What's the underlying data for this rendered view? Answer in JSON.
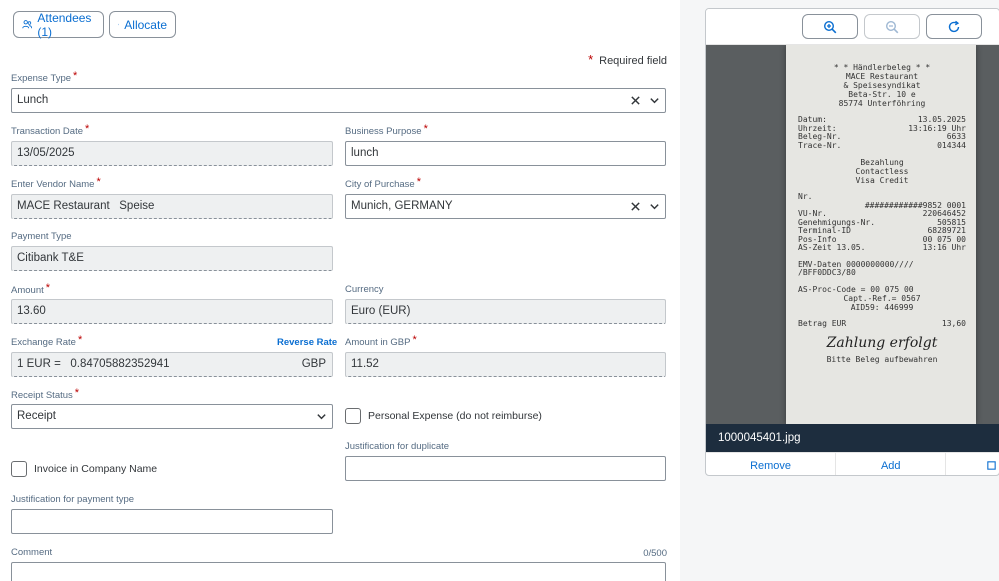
{
  "toolbar": {
    "attendees_label": "Attendees (1)",
    "allocate_label": "Allocate"
  },
  "required_note": "Required field",
  "form": {
    "expense_type": {
      "label": "Expense Type",
      "value": "Lunch"
    },
    "transaction_date": {
      "label": "Transaction Date",
      "value": "13/05/2025"
    },
    "business_purpose": {
      "label": "Business Purpose",
      "value": "lunch"
    },
    "vendor_name": {
      "label": "Enter Vendor Name",
      "value": "MACE Restaurant   Speise"
    },
    "city_of_purchase": {
      "label": "City of Purchase",
      "value": "Munich, GERMANY"
    },
    "payment_type": {
      "label": "Payment Type",
      "value": "Citibank T&E"
    },
    "amount": {
      "label": "Amount",
      "value": "13.60"
    },
    "currency": {
      "label": "Currency",
      "value": "Euro (EUR)"
    },
    "exchange_rate": {
      "label": "Exchange Rate",
      "reverse_label": "Reverse Rate",
      "prefix": "1 EUR =",
      "value": "0.84705882352941",
      "suffix": "GBP"
    },
    "amount_in_gbp": {
      "label": "Amount in GBP",
      "value": "11.52"
    },
    "receipt_status": {
      "label": "Receipt Status",
      "value": "Receipt"
    },
    "personal_expense": {
      "label": "Personal Expense (do not reimburse)",
      "checked": false
    },
    "justification_duplicate": {
      "label": "Justification for duplicate",
      "value": ""
    },
    "invoice_company": {
      "label": "Invoice in Company Name",
      "checked": false
    },
    "justification_payment": {
      "label": "Justification for payment type",
      "value": ""
    },
    "comment": {
      "label": "Comment",
      "value": "",
      "counter": "0/500"
    }
  },
  "viewer": {
    "icons": [
      "zoom-in-icon",
      "zoom-out-icon",
      "refresh-icon"
    ],
    "file_name": "1000045401.jpg",
    "remove_label": "Remove",
    "add_label": "Add",
    "receipt": {
      "header": [
        "* * Händlerbeleg * *",
        "MACE Restaurant",
        "& Speisesyndikat",
        "Beta-Str. 10 e",
        "85774 Unterföhring"
      ],
      "datum_label": "Datum:",
      "datum": "13.05.2025",
      "uhrzeit_label": "Uhrzeit:",
      "uhrzeit": "13:16:19 Uhr",
      "beleg_label": "Beleg-Nr.",
      "beleg": "6633",
      "trace_label": "Trace-Nr.",
      "trace": "014344",
      "payment": [
        "Bezahlung",
        "Contactless",
        "Visa Credit"
      ],
      "nr_label": "Nr.",
      "card": "############9852 0001",
      "vu_label": "VU-Nr.",
      "vu": "220646452",
      "gen_label": "Genehmigungs-Nr.",
      "gen": "505815",
      "term_label": "Terminal-ID",
      "term": "68289721",
      "pos_label": "Pos-Info",
      "pos": "00 075 00",
      "as_label": "AS-Zeit 13.05.",
      "as": "13:16 Uhr",
      "emv1": "EMV-Daten 0000000000////",
      "emv2": "/BFF0DDC3/80",
      "asproc": "AS-Proc-Code = 00 075 00",
      "capt": "Capt.-Ref.= 0567",
      "aid": "AID59: 446999",
      "betrag_label": "Betrag EUR",
      "betrag": "13,60",
      "zahlung": "Zahlung erfolgt",
      "footer": "Bitte Beleg aufbewahren"
    }
  }
}
